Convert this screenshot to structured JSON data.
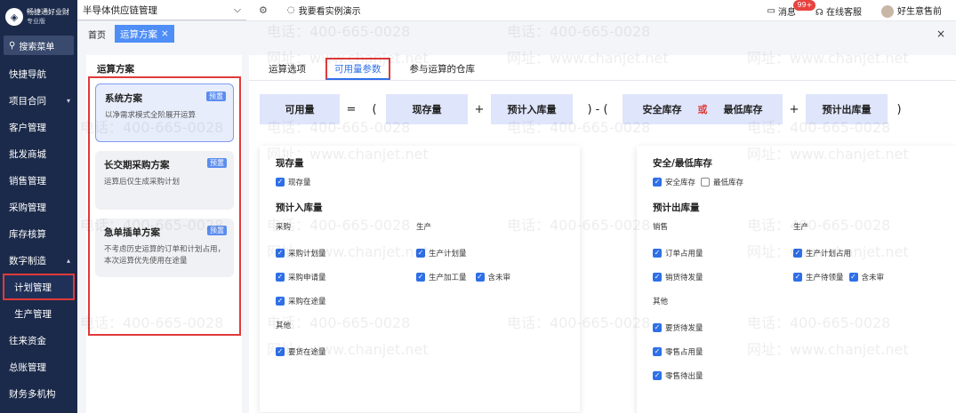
{
  "brand": {
    "name": "畅捷通好业财",
    "edition": "专业版"
  },
  "sidebar": {
    "search_label": "搜索菜单",
    "items": [
      {
        "label": "快捷导航"
      },
      {
        "label": "项目合同",
        "caret": "▾"
      },
      {
        "label": "客户管理"
      },
      {
        "label": "批发商城"
      },
      {
        "label": "销售管理"
      },
      {
        "label": "采购管理"
      },
      {
        "label": "库存核算"
      },
      {
        "label": "数字制造",
        "caret": "▴"
      },
      {
        "label": "计划管理"
      },
      {
        "label": "生产管理"
      },
      {
        "label": "往来资金"
      },
      {
        "label": "总账管理"
      },
      {
        "label": "财务多机构"
      }
    ]
  },
  "topbar": {
    "company": "半导体供应链管理",
    "demo": "我要看实例演示",
    "message": "消息",
    "message_badge": "99+",
    "service": "在线客服",
    "user": "好生意售前"
  },
  "tabs": {
    "home": "首页",
    "active": "运算方案",
    "close": "×"
  },
  "left_panel": {
    "title": "运算方案",
    "preset_label": "预置",
    "plans": [
      {
        "name": "系统方案",
        "desc": "以净需求模式全阶展开运算"
      },
      {
        "name": "长交期采购方案",
        "desc": "运算后仅生成采购计划"
      },
      {
        "name": "急单插单方案",
        "desc": "不考虑历史运算的订单和计划占用，本次运算优先使用在途量"
      }
    ]
  },
  "content_tabs": [
    "运算选项",
    "可用量参数",
    "参与运算的仓库"
  ],
  "formula": {
    "available": "可用量",
    "eq": "=",
    "lparen": "(",
    "onhand": "现存量",
    "plus": "+",
    "planned_in": "预计入库量",
    "rparen_minus": ") - (",
    "safety": "安全库存",
    "or": "或",
    "min_stock": "最低库存",
    "planned_out": "预计出库量",
    "rparen": ")"
  },
  "left_card": {
    "onhand_title": "现存量",
    "onhand_cb": "现存量",
    "planned_in_title": "预计入库量",
    "purchase_group": "采购",
    "production_group": "生产",
    "purchase_plan": "采购计划量",
    "purchase_request": "采购申请量",
    "purchase_transit": "采购在途量",
    "production_plan": "生产计划量",
    "production_process": "生产加工量",
    "unapproved": "含未审",
    "other_group": "其他",
    "goods_transit": "要货在途量"
  },
  "right_card": {
    "safety_title": "安全/最低库存",
    "safety_cb": "安全库存",
    "min_cb": "最低库存",
    "planned_out_title": "预计出库量",
    "sales_group": "销售",
    "production_group": "生产",
    "order_occupy": "订单占用量",
    "sales_pending": "销货待发量",
    "production_plan_occupy": "生产计划占用",
    "production_pending": "生产待领量",
    "unapproved": "含未审",
    "other_group": "其他",
    "goods_pending": "要货待发量",
    "retail_occupy": "零售占用量",
    "retail_pending": "零售待出量"
  },
  "watermark": {
    "phone": "电话：400-665-0028",
    "site": "网址：www.chanjet.net"
  }
}
